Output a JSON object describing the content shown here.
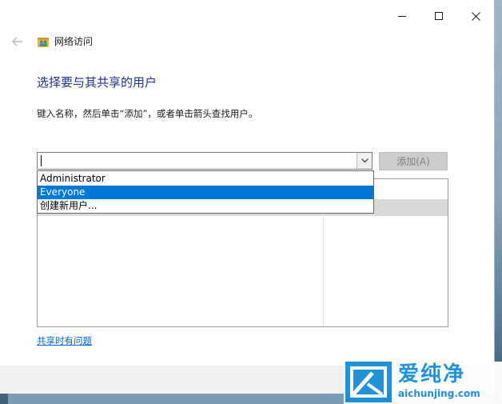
{
  "window": {
    "title": "网络访问",
    "controls": {
      "minimize": "minimize-icon",
      "maximize": "maximize-icon",
      "close": "close-icon"
    }
  },
  "page": {
    "heading": "选择要与其共享的用户",
    "instruction": "键入名称，然后单击“添加”，或者单击箭头查找用户。"
  },
  "user_combo": {
    "value": "",
    "dropdown_items": [
      {
        "label": "Administrator",
        "selected": false
      },
      {
        "label": "Everyone",
        "selected": true
      },
      {
        "label": "创建新用户...",
        "selected": false
      }
    ]
  },
  "add_button": {
    "label": "添加(A)",
    "enabled": false
  },
  "help_link": "共享时有问题",
  "watermark": {
    "title": "爱纯净",
    "url": "aichunjing.com"
  },
  "colors": {
    "heading": "#1e3287",
    "selection": "#0078d7",
    "link": "#0066cc",
    "watermark": "#1c8ed6"
  }
}
